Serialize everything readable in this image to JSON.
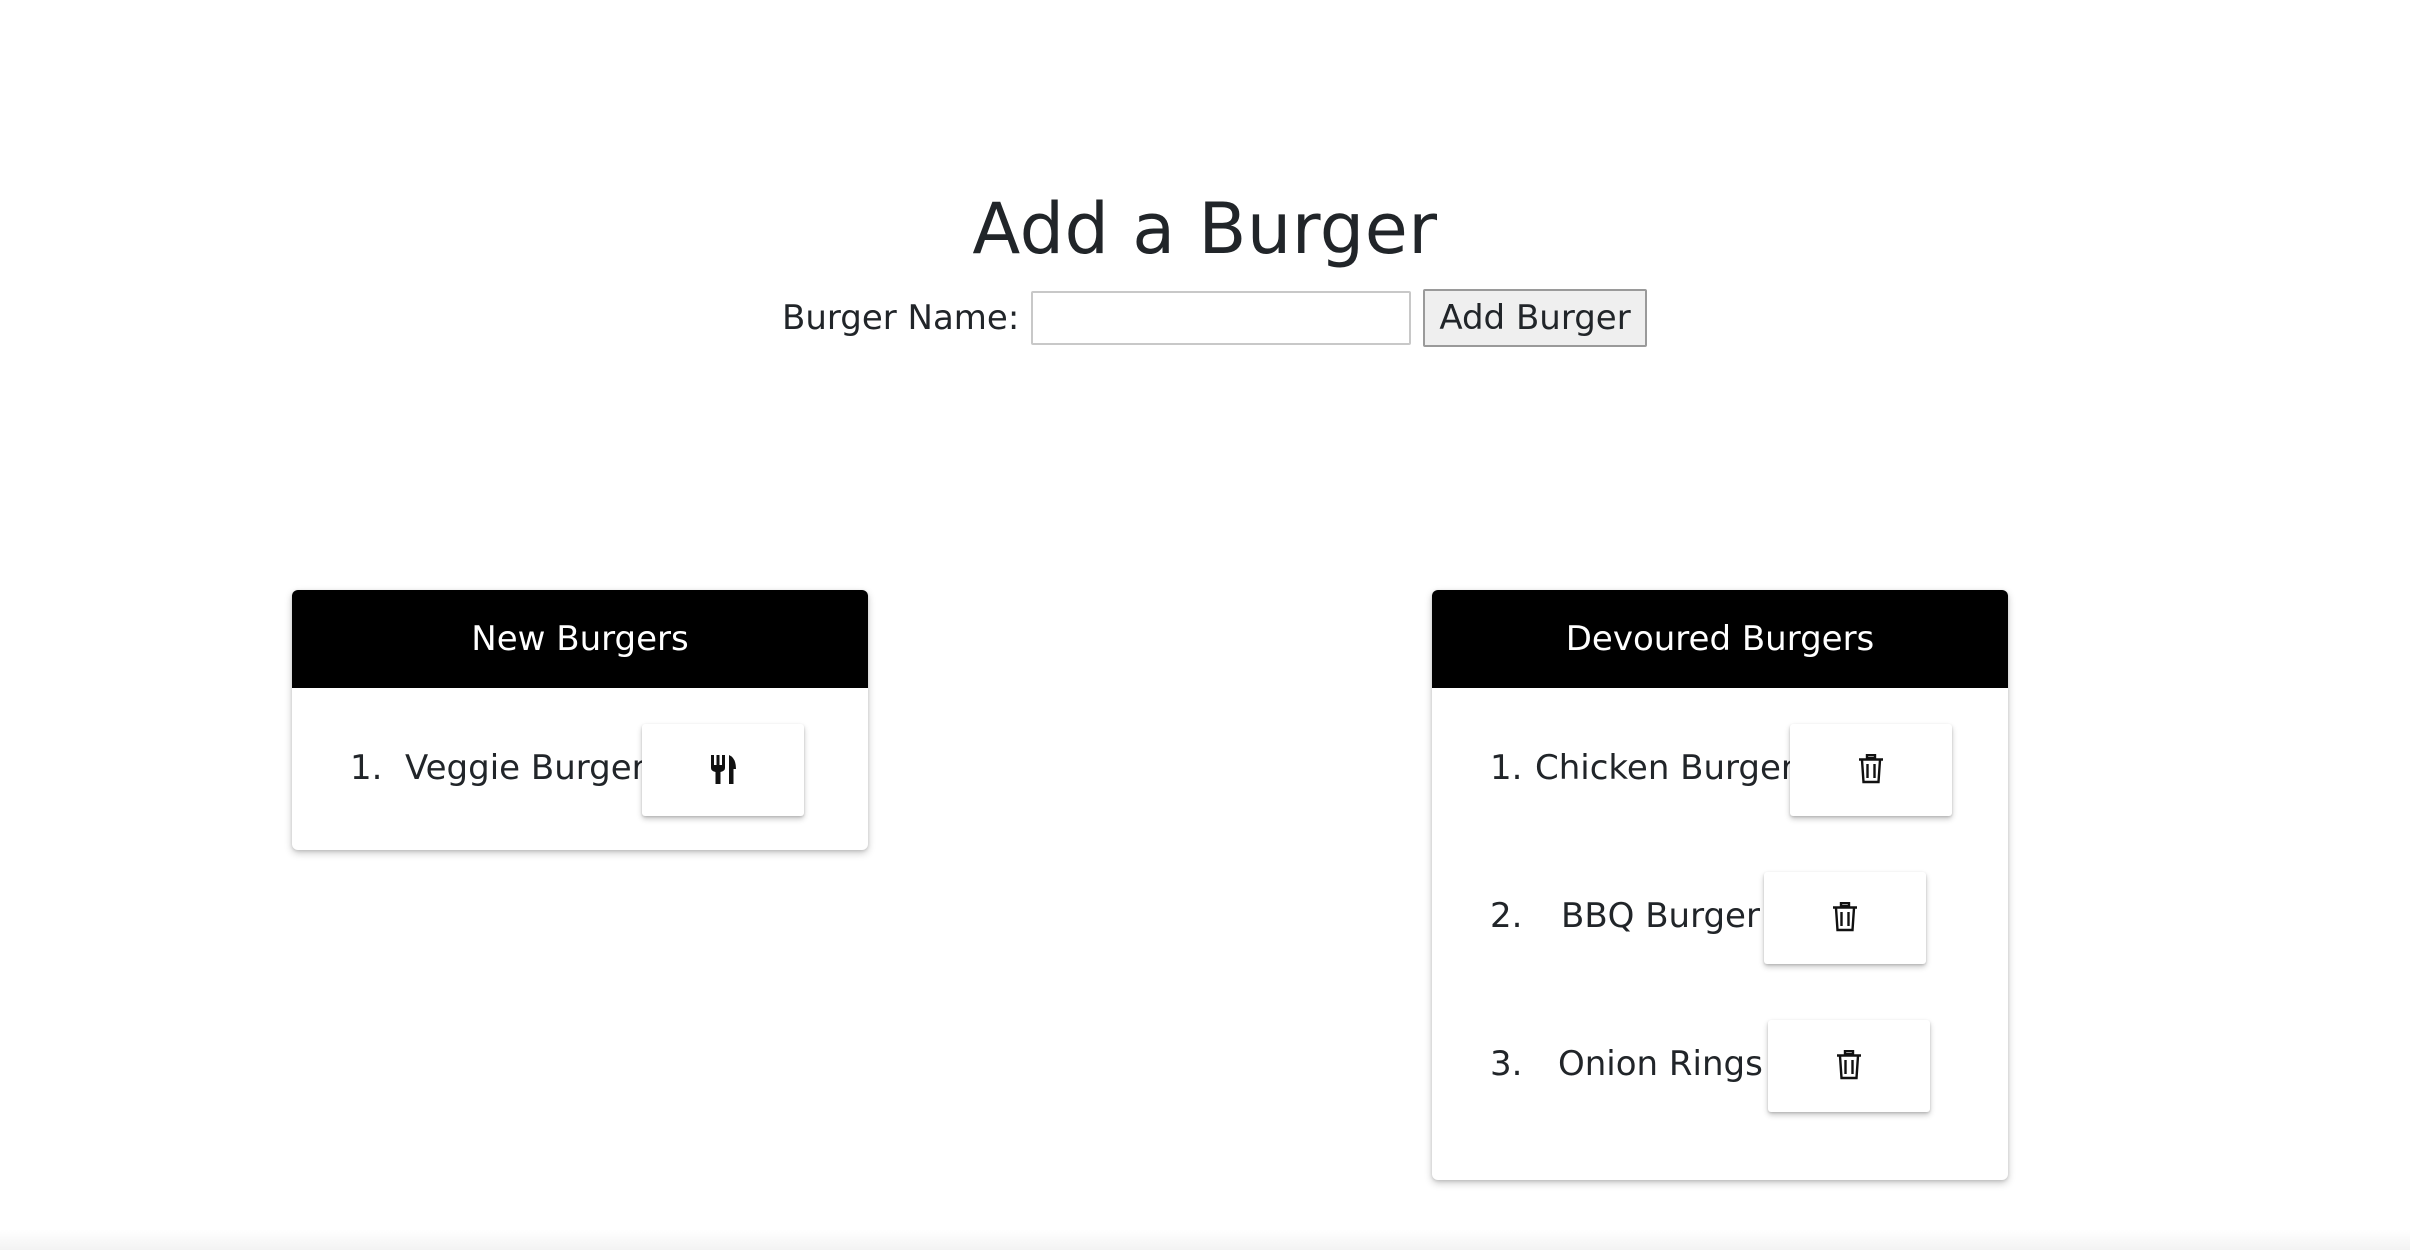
{
  "header": {
    "title": "Add a Burger"
  },
  "form": {
    "label": "Burger Name:",
    "input_value": "",
    "input_placeholder": "",
    "submit_label": "Add Burger"
  },
  "new_burgers": {
    "title": "New Burgers",
    "items": [
      {
        "number": "1.",
        "name": "Veggie Burger",
        "action_icon": "fork-knife-icon"
      }
    ]
  },
  "devoured_burgers": {
    "title": "Devoured Burgers",
    "items": [
      {
        "number": "1.",
        "name": "Chicken Burger",
        "action_icon": "trash-icon"
      },
      {
        "number": "2.",
        "name": "BBQ Burger",
        "action_icon": "trash-icon"
      },
      {
        "number": "3.",
        "name": "Onion Rings",
        "action_icon": "trash-icon"
      }
    ]
  }
}
